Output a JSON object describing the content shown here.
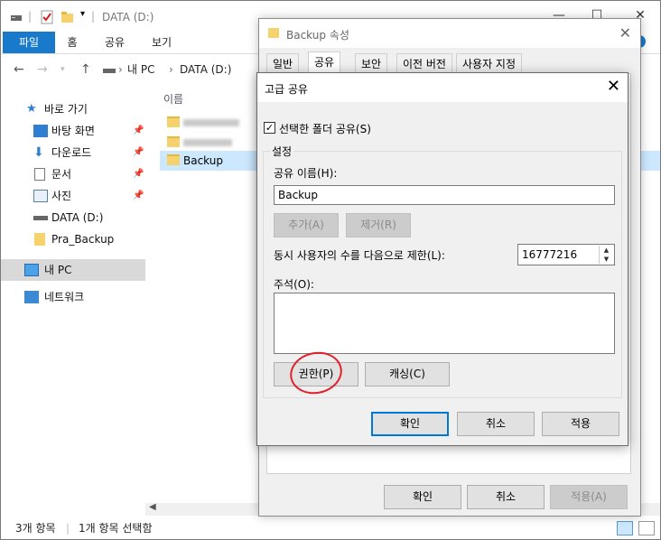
{
  "explorer": {
    "title": "DATA (D:)",
    "ribbon_tabs": [
      "파일",
      "홈",
      "공유",
      "보기"
    ],
    "address": "내 PC  ›  DATA (D:)",
    "address_parts": [
      "내 PC",
      "DATA (D:)"
    ],
    "nav": {
      "quick_access": "바로 가기",
      "desktop": "바탕 화면",
      "downloads": "다운로드",
      "documents": "문서",
      "pictures": "사진",
      "data_drive": "DATA (D:)",
      "pra_backup": "Pra_Backup",
      "this_pc": "내 PC",
      "network": "네트워크"
    },
    "column_name": "이름",
    "files": [
      "Backup"
    ],
    "status": {
      "item_count": "3개 항목",
      "selected": "1개 항목 선택함"
    }
  },
  "properties": {
    "title": "Backup 속성",
    "tabs": [
      "일반",
      "공유",
      "보안",
      "이전 버전",
      "사용자 지정"
    ],
    "ok": "확인",
    "cancel": "취소",
    "apply": "적용(A)"
  },
  "advanced_sharing": {
    "title": "고급 공유",
    "share_checkbox": "선택한 폴더 공유(S)",
    "share_checked": true,
    "settings_group": "설정",
    "share_name_label": "공유 이름(H):",
    "share_name_value": "Backup",
    "add_button": "추가(A)",
    "remove_button": "제거(R)",
    "user_limit_label": "동시 사용자의 수를 다음으로 제한(L):",
    "user_limit_value": "16777216",
    "comment_label": "주석(O):",
    "comment_value": "",
    "permissions_button": "권한(P)",
    "caching_button": "캐싱(C)",
    "ok": "확인",
    "cancel": "취소",
    "apply": "적용"
  },
  "colors": {
    "ribbon_file": "#1979ca",
    "selection": "#cce8ff",
    "highlight_circle": "#e0202a",
    "default_button_border": "#0078d7"
  }
}
